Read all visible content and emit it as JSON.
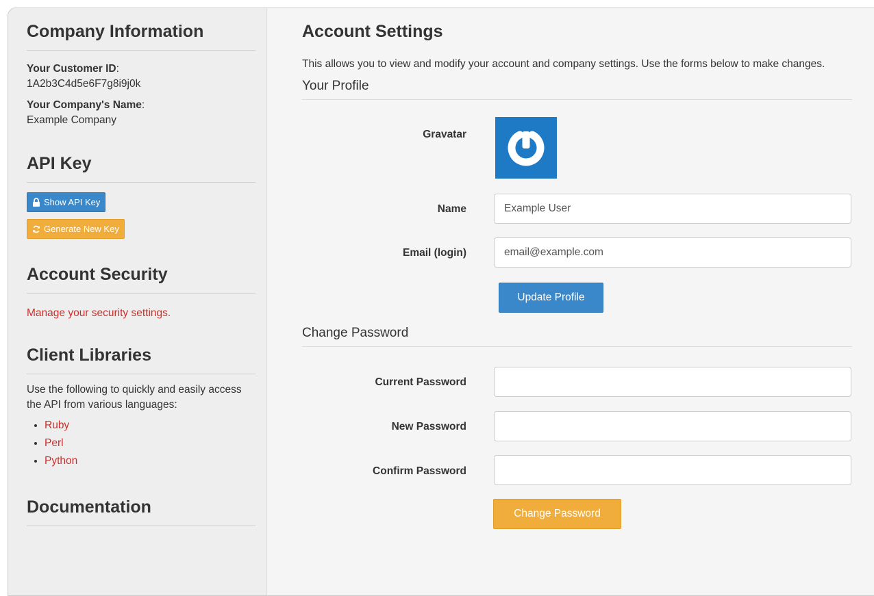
{
  "sidebar": {
    "company": {
      "heading": "Company Information",
      "customer_id_label": "Your Customer ID",
      "customer_id_sep": ":",
      "customer_id_value": "1A2b3C4d5e6F7g8i9j0k",
      "company_name_label": "Your Company's Name",
      "company_name_sep": ":",
      "company_name_value": "Example Company"
    },
    "api_key": {
      "heading": "API Key",
      "show_label": "Show API Key",
      "generate_label": "Generate New Key"
    },
    "security": {
      "heading": "Account Security",
      "link": "Manage your security settings."
    },
    "libraries": {
      "heading": "Client Libraries",
      "description": "Use the following to quickly and easily access the API from various languages:",
      "items": [
        "Ruby",
        "Perl",
        "Python"
      ]
    },
    "documentation": {
      "heading": "Documentation"
    }
  },
  "main": {
    "title": "Account Settings",
    "intro": "This allows you to view and modify your account and company settings. Use the forms below to make changes.",
    "profile": {
      "section_title": "Your Profile",
      "gravatar_label": "Gravatar",
      "name_label": "Name",
      "name_value": "Example User",
      "email_label": "Email (login)",
      "email_value": "email@example.com",
      "update_button": "Update Profile"
    },
    "password": {
      "section_title": "Change Password",
      "current_label": "Current Password",
      "new_label": "New Password",
      "confirm_label": "Confirm Password",
      "change_button": "Change Password"
    }
  },
  "colors": {
    "primary_blue": "#3a87c9",
    "warning_orange": "#f0ad3c",
    "link_red": "#c9302c",
    "gravatar_bg": "#1e7ac4"
  },
  "icons": {
    "show_key": "lock-icon",
    "generate_key": "refresh-icon",
    "gravatar": "gravatar-logo"
  }
}
